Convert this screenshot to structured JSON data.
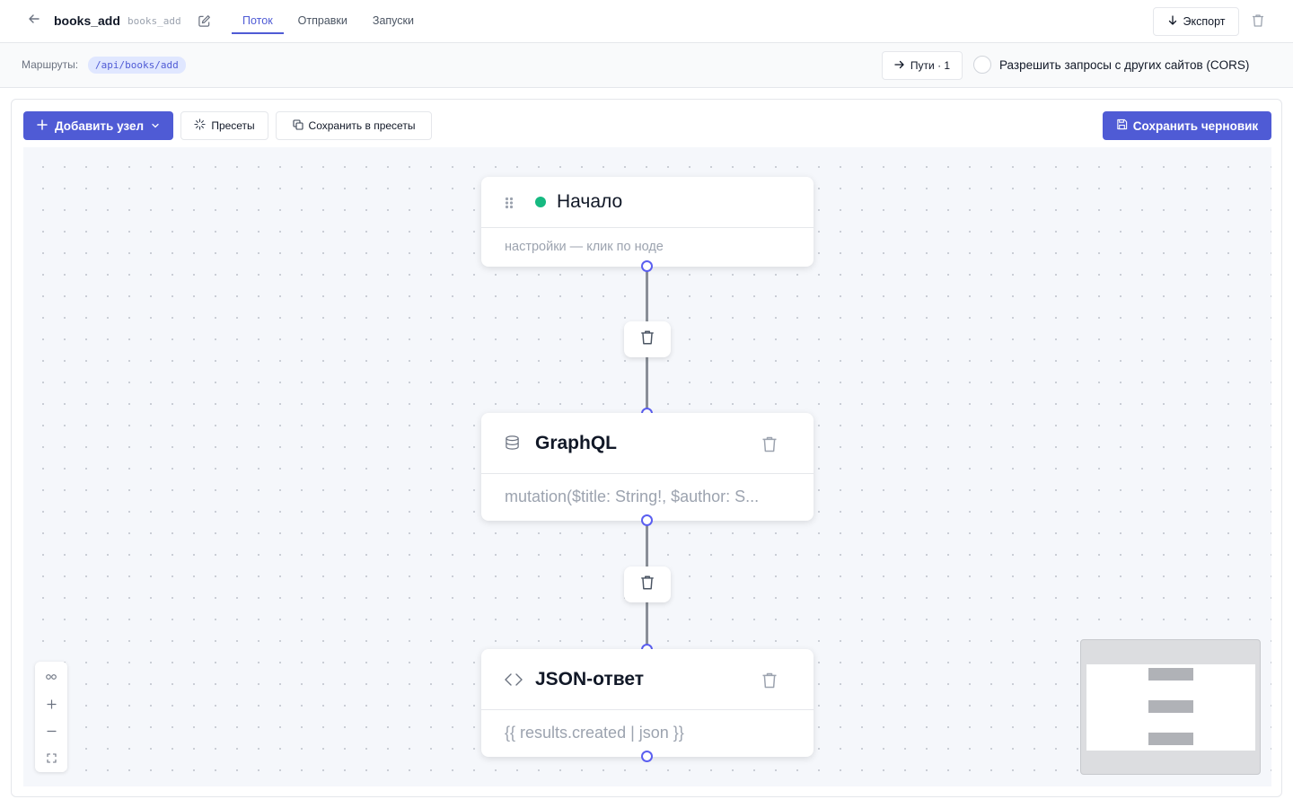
{
  "header": {
    "flow_name": "books_add",
    "flow_slug": "books_add",
    "tabs": [
      {
        "label": "Поток",
        "active": true
      },
      {
        "label": "Отправки",
        "active": false
      },
      {
        "label": "Запуски",
        "active": false
      }
    ],
    "export_label": "Экспорт"
  },
  "routes": {
    "label": "Маршруты:",
    "items": [
      "/api/books/add"
    ],
    "paths_label": "Пути · 1",
    "cors_label": "Разрешить запросы с других сайтов (CORS)",
    "cors_enabled": false
  },
  "toolbar": {
    "add_node_label": "Добавить узел",
    "presets_label": "Пресеты",
    "save_presets_label": "Сохранить в пресеты",
    "save_draft_label": "Сохранить черновик"
  },
  "nodes": [
    {
      "title": "Начало",
      "body": "настройки — клик по ноде",
      "status_color": "#16b981"
    },
    {
      "title": "GraphQL",
      "body": "mutation($title: String!, $author: S..."
    },
    {
      "title": "JSON-ответ",
      "body": "{{ results.created | json }}"
    }
  ],
  "colors": {
    "accent": "#4f5bd5",
    "handle": "#5b5ff0",
    "edge": "#8a8f98"
  },
  "icons": {
    "back": "arrow-left-icon",
    "edit": "pencil-square-icon",
    "export": "arrow-down-icon",
    "delete": "trash-icon",
    "paths": "arrow-right-icon",
    "add": "plus-icon",
    "presets": "sparkle-icon",
    "save_presets": "copy-icon",
    "save_draft": "floppy-disk-icon",
    "drag": "grip-icon",
    "database": "database-icon",
    "code": "code-icon",
    "fit": "fit-view-icon",
    "zoom_in": "zoom-in-icon",
    "zoom_out": "zoom-out-icon",
    "fullscreen": "fullscreen-icon"
  }
}
